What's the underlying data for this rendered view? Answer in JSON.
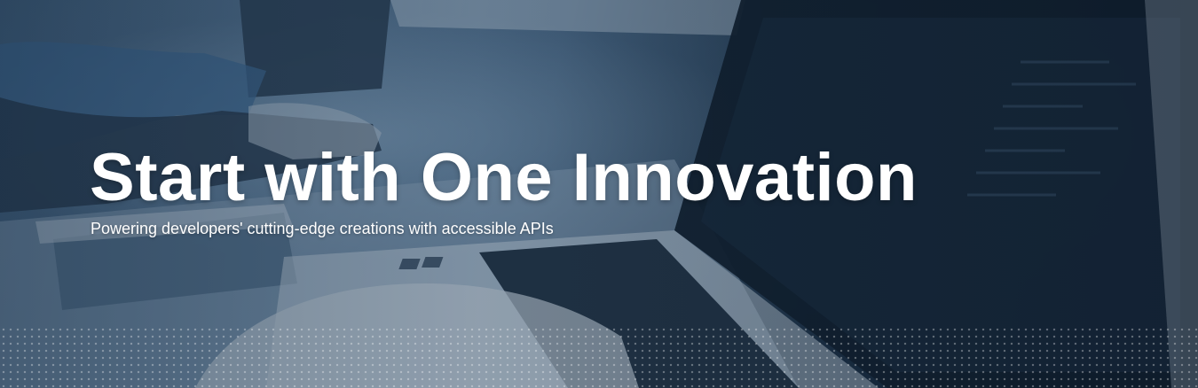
{
  "hero": {
    "title": "Start with One Innovation",
    "subtitle": "Powering developers' cutting-edge creations with accessible APIs",
    "background_image": "hands typing on laptop keyboard",
    "overlay_color": "#1f3346",
    "text_color": "#ffffff"
  }
}
